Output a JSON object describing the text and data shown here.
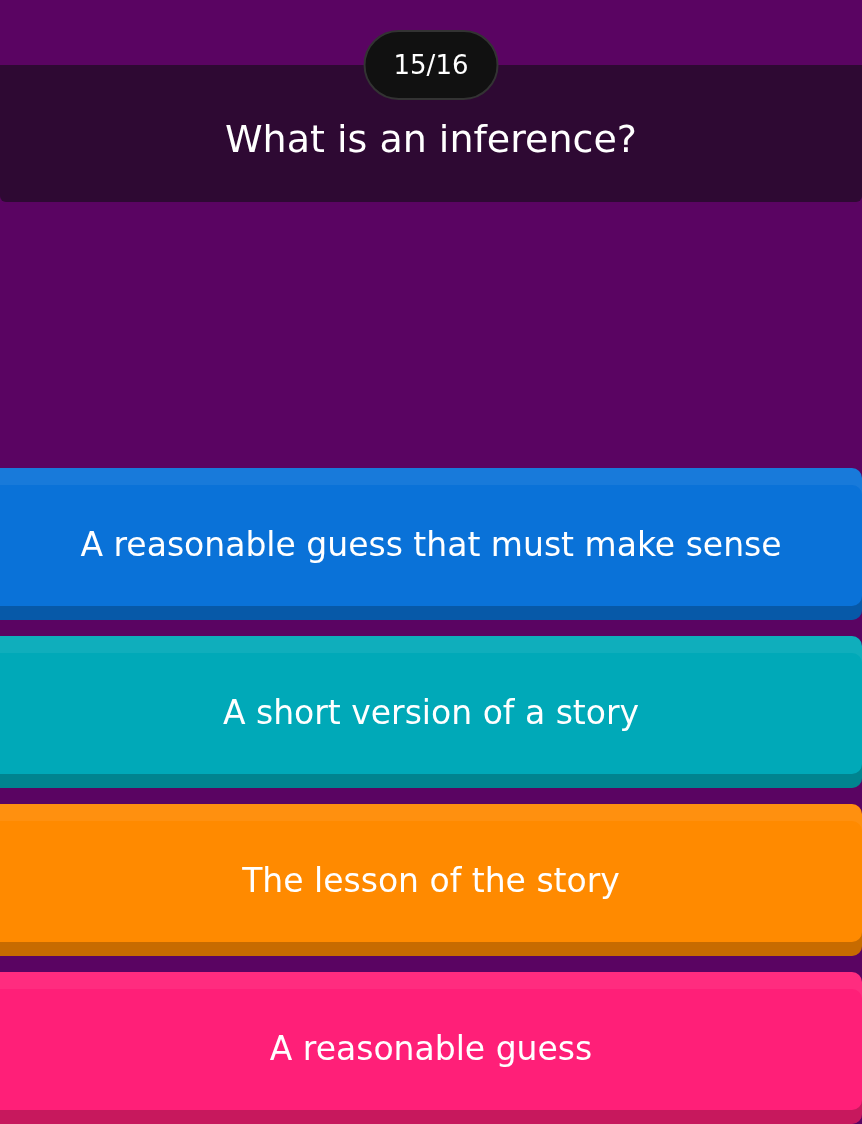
{
  "counter": "15/16",
  "question": "What is an inference?",
  "options": [
    {
      "text": "A reasonable guess that must make sense",
      "color": "#0a72d8"
    },
    {
      "text": "A short version of a story",
      "color": "#00a9b8"
    },
    {
      "text": "The lesson of the story",
      "color": "#ff8a00"
    },
    {
      "text": "A reasonable guess",
      "color": "#ff1f78"
    }
  ]
}
